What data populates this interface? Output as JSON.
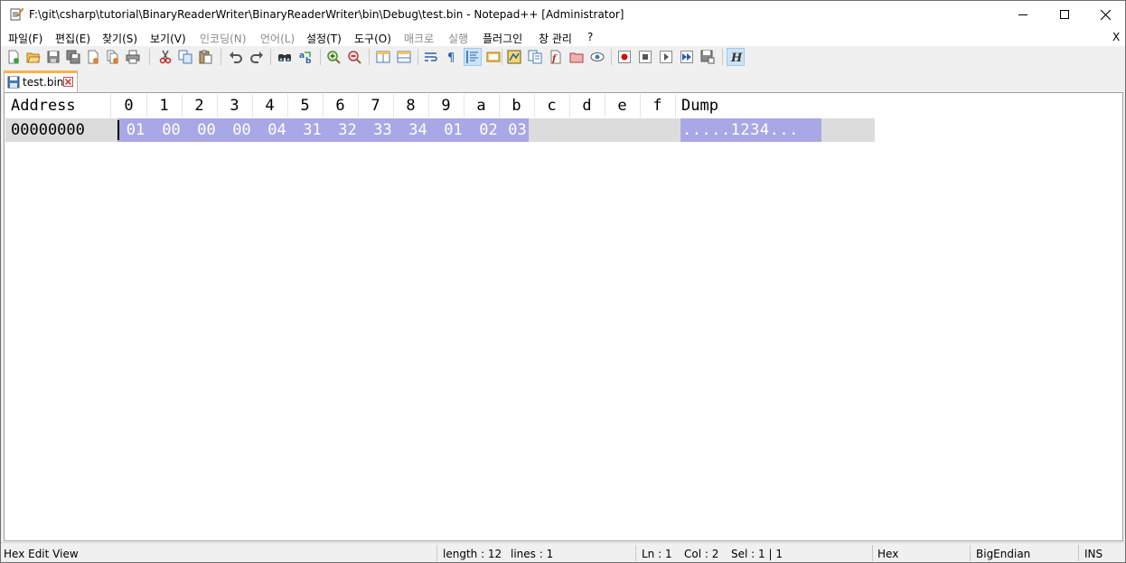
{
  "window": {
    "title": "F:\\git\\csharp\\tutorial\\BinaryReaderWriter\\BinaryReaderWriter\\bin\\Debug\\test.bin - Notepad++ [Administrator]"
  },
  "menu": {
    "items": [
      "파일(F)",
      "편집(E)",
      "찾기(S)",
      "보기(V)",
      "인코딩(N)",
      "언어(L)",
      "설정(T)",
      "도구(O)",
      "매크로",
      "실행",
      "플러그인",
      "창 관리",
      "?"
    ],
    "close_label": "X"
  },
  "toolbar": {
    "icons": [
      "new-file-icon",
      "open-file-icon",
      "save-icon",
      "save-all-icon",
      "close-icon",
      "close-all-icon",
      "print-icon",
      "cut-icon",
      "copy-icon",
      "paste-icon",
      "undo-icon",
      "redo-icon",
      "find-icon",
      "replace-icon",
      "zoom-in-icon",
      "zoom-out-icon",
      "sync-vertical-icon",
      "sync-horizontal-icon",
      "word-wrap-icon",
      "show-all-characters-icon",
      "indent-guide-icon",
      "user-defined-language-icon",
      "document-map-icon",
      "document-list-icon",
      "function-list-icon",
      "folder-as-workspace-icon",
      "monitoring-icon",
      "record-macro-icon",
      "stop-macro-icon",
      "play-macro-icon",
      "run-macro-multiple-icon",
      "save-macro-icon",
      "hex-editor-icon"
    ]
  },
  "tab": {
    "label": "test.bin"
  },
  "hex_view": {
    "header": {
      "address": "Address",
      "columns": [
        "0",
        "1",
        "2",
        "3",
        "4",
        "5",
        "6",
        "7",
        "8",
        "9",
        "a",
        "b",
        "c",
        "d",
        "e",
        "f"
      ],
      "dump": "Dump"
    },
    "rows": [
      {
        "address": "00000000",
        "bytes": [
          "01",
          "00",
          "00",
          "00",
          "04",
          "31",
          "32",
          "33",
          "34",
          "01",
          "02",
          "03"
        ],
        "dump": ".....1234..."
      }
    ]
  },
  "status": {
    "mode": "Hex Edit View",
    "length": "length : 12",
    "lines": "lines : 1",
    "ln": "Ln : 1",
    "col": "Col : 2",
    "sel": "Sel : 1 | 1",
    "view": "Hex",
    "endian": "BigEndian",
    "ins": "INS"
  },
  "colors": {
    "selection": "#a8a8e6",
    "row_background": "#dcdcdc",
    "tab_accent": "#fab249"
  }
}
